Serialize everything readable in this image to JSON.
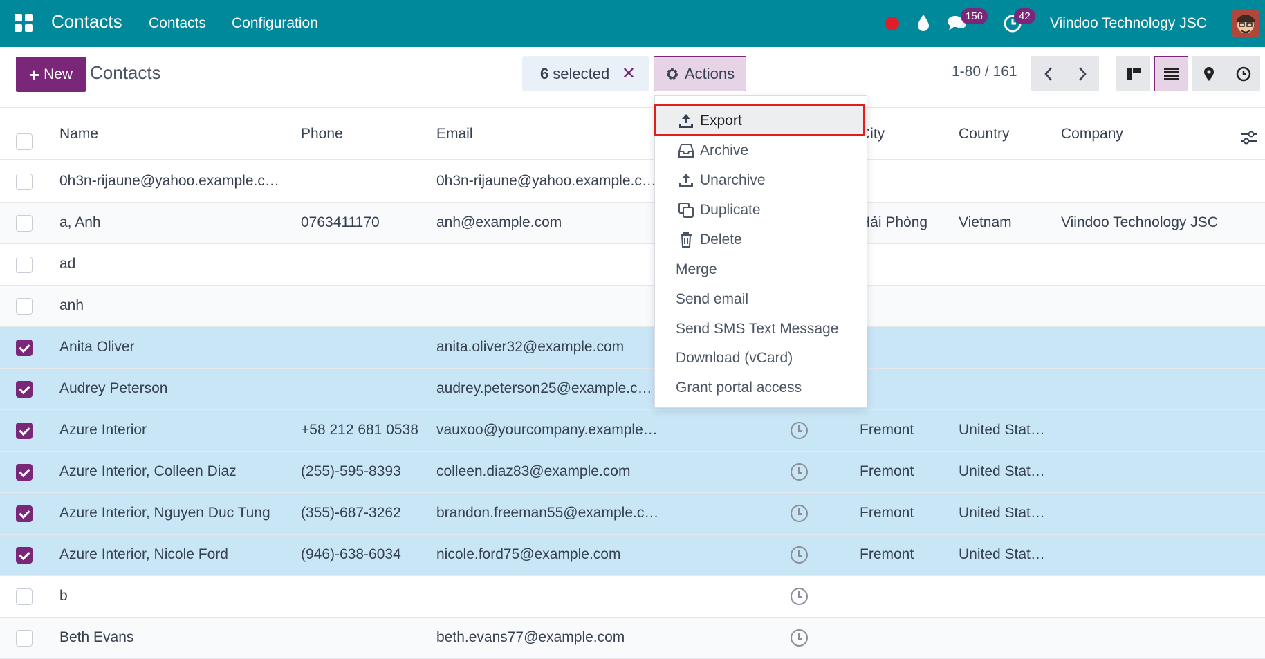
{
  "navbar": {
    "brand": "Contacts",
    "links": [
      "Contacts",
      "Configuration"
    ],
    "messages_badge": "156",
    "activities_badge": "42",
    "company": "Viindoo Technology JSC"
  },
  "control_panel": {
    "new_label": "New",
    "title": "Contacts",
    "selected_count": "6",
    "selected_text": "selected",
    "actions_label": "Actions",
    "pager": "1-80 / 161"
  },
  "table": {
    "columns": {
      "name": "Name",
      "phone": "Phone",
      "email": "Email",
      "city": "City",
      "country": "Country",
      "company": "Company"
    },
    "rows": [
      {
        "name": "0h3n-rijaune@yahoo.example.c…",
        "phone": "",
        "email": "0h3n-rijaune@yahoo.example.c…",
        "city": "",
        "country": "",
        "company": "",
        "selected": false,
        "clock": false
      },
      {
        "name": "a, Anh",
        "phone": "0763411170",
        "email": "anh@example.com",
        "city": "Hải Phòng",
        "country": "Vietnam",
        "company": "Viindoo Technology JSC",
        "selected": false,
        "clock": false
      },
      {
        "name": "ad",
        "phone": "",
        "email": "",
        "city": "",
        "country": "",
        "company": "",
        "selected": false,
        "clock": false
      },
      {
        "name": "anh",
        "phone": "",
        "email": "",
        "city": "",
        "country": "",
        "company": "",
        "selected": false,
        "clock": false
      },
      {
        "name": "Anita Oliver",
        "phone": "",
        "email": "anita.oliver32@example.com",
        "city": "",
        "country": "",
        "company": "",
        "selected": true,
        "clock": false
      },
      {
        "name": "Audrey Peterson",
        "phone": "",
        "email": "audrey.peterson25@example.c…",
        "city": "",
        "country": "",
        "company": "",
        "selected": true,
        "clock": false
      },
      {
        "name": "Azure Interior",
        "phone": "+58 212 681 0538",
        "email": "vauxoo@yourcompany.example…",
        "city": "Fremont",
        "country": "United Stat…",
        "company": "",
        "selected": true,
        "clock": true
      },
      {
        "name": "Azure Interior, Colleen Diaz",
        "phone": "(255)-595-8393",
        "email": "colleen.diaz83@example.com",
        "city": "Fremont",
        "country": "United Stat…",
        "company": "",
        "selected": true,
        "clock": true
      },
      {
        "name": "Azure Interior, Nguyen Duc Tung",
        "phone": "(355)-687-3262",
        "email": "brandon.freeman55@example.c…",
        "city": "Fremont",
        "country": "United Stat…",
        "company": "",
        "selected": true,
        "clock": true
      },
      {
        "name": "Azure Interior, Nicole Ford",
        "phone": "(946)-638-6034",
        "email": "nicole.ford75@example.com",
        "city": "Fremont",
        "country": "United Stat…",
        "company": "",
        "selected": true,
        "clock": true
      },
      {
        "name": "b",
        "phone": "",
        "email": "",
        "city": "",
        "country": "",
        "company": "",
        "selected": false,
        "clock": true
      },
      {
        "name": "Beth Evans",
        "phone": "",
        "email": "beth.evans77@example.com",
        "city": "",
        "country": "",
        "company": "",
        "selected": false,
        "clock": true
      }
    ]
  },
  "actions_menu": {
    "export": "Export",
    "archive": "Archive",
    "unarchive": "Unarchive",
    "duplicate": "Duplicate",
    "delete": "Delete",
    "merge": "Merge",
    "send_email": "Send email",
    "send_sms": "Send SMS Text Message",
    "download_vcard": "Download (vCard)",
    "grant_portal": "Grant portal access"
  },
  "colors": {
    "navbar": "#00889b",
    "brand_purple": "#7a2779",
    "selected_row": "#c9e6f7",
    "highlight_red": "#e11d1d"
  }
}
